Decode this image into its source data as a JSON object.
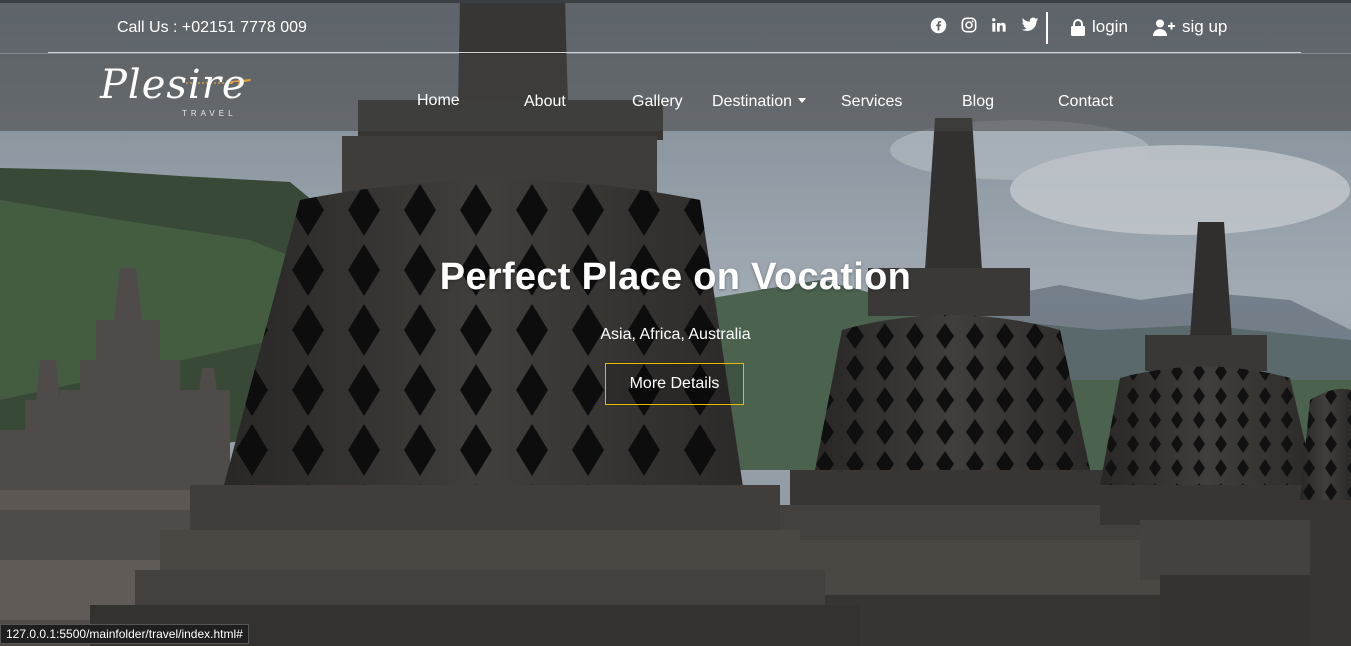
{
  "topbar": {
    "call_text": "Call Us : +02151 7778 009",
    "social_icons": [
      "facebook-icon",
      "instagram-icon",
      "linkedin-icon",
      "twitter-icon"
    ],
    "login_label": "login",
    "signup_label": "sig up"
  },
  "logo": {
    "name": "Plesire",
    "tagline": "TRAVEL"
  },
  "nav": {
    "items": [
      {
        "label": "Home"
      },
      {
        "label": "About"
      },
      {
        "label": "Gallery"
      },
      {
        "label": "Destination"
      },
      {
        "label": "Services"
      },
      {
        "label": "Blog"
      },
      {
        "label": "Contact"
      }
    ]
  },
  "hero": {
    "title": "Perfect Place on Vocation",
    "subtitle": "Asia, Africa, Australia",
    "button_label": "More Details"
  },
  "status_url": "127.0.0.1:5500/mainfolder/travel/index.html#",
  "colors": {
    "accent": "#e6b800",
    "plane": "#e8a33c"
  }
}
